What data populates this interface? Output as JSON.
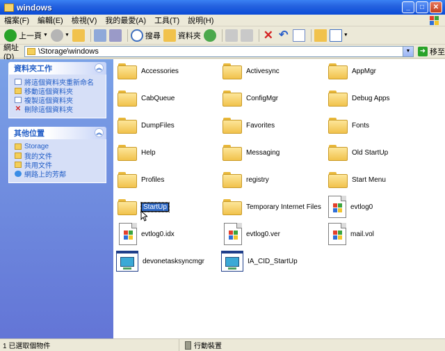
{
  "window": {
    "title": "windows"
  },
  "menu": [
    "檔案(F)",
    "編輯(E)",
    "檢視(V)",
    "我的最愛(A)",
    "工具(T)",
    "說明(H)"
  ],
  "toolbar": {
    "back_label": "上一頁",
    "search_label": "搜尋",
    "folders_label": "資料夾"
  },
  "address": {
    "label": "網址(D)",
    "value": "\\Storage\\windows",
    "go_label": "移至"
  },
  "left_pane": {
    "tasks": {
      "title": "資料夾工作",
      "links": [
        "將這個資料夾重新命名",
        "移動這個資料夾",
        "複製這個資料夾",
        "刪除這個資料夾"
      ]
    },
    "places": {
      "title": "其他位置",
      "links": [
        "Storage",
        "我的文件",
        "共用文件",
        "網路上的芳鄰"
      ]
    }
  },
  "items": [
    "Accessories",
    "Activesync",
    "AppMgr",
    "CabQueue",
    "ConfigMgr",
    "Debug Apps",
    "DumpFiles",
    "Favorites",
    "Fonts",
    "Help",
    "Messaging",
    "Old StartUp",
    "Profiles",
    "registry",
    "Start Menu",
    "StartUp",
    "Temporary Internet Files",
    "evtlog0",
    "evtlog0.idx",
    "evtlog0.ver",
    "mail.vol",
    "devonetasksyncmgr",
    "IA_CID_StartUp"
  ],
  "status": {
    "left": "1 已選取個物件",
    "right": "行動裝置"
  },
  "colors": {
    "title_bar": "#0a4bd6",
    "task_pane": "#6375d6",
    "selection": "#316ac5",
    "folder": "#f1c24c"
  }
}
